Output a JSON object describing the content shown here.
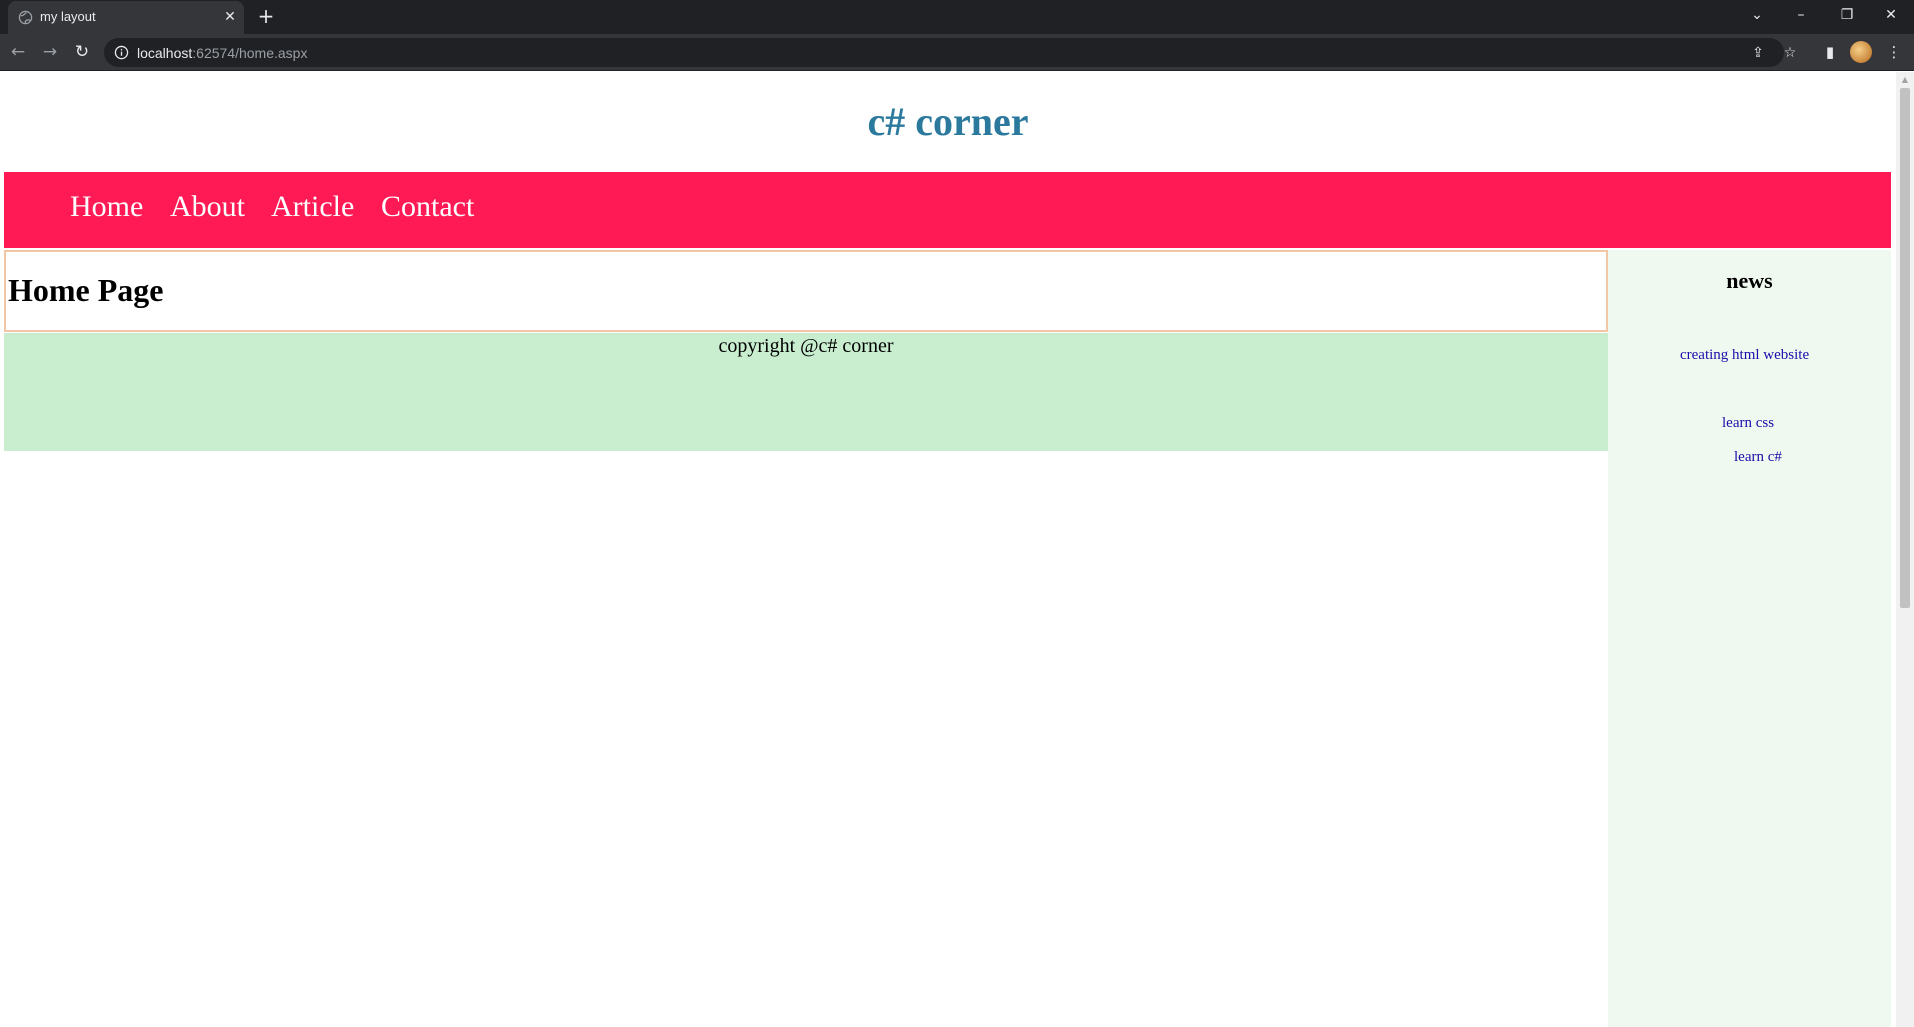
{
  "browser": {
    "tab_title": "my layout",
    "close_glyph": "✕",
    "new_tab_glyph": "+",
    "url_host": "localhost",
    "url_rest": ":62574/home.aspx",
    "window_controls": {
      "tab_search": "⌄",
      "minimize": "–",
      "restore": "❐",
      "close": "✕"
    },
    "nav_glyphs": {
      "back": "←",
      "forward": "→",
      "reload": "↻"
    },
    "toolbar_glyphs": {
      "share": "⇪",
      "bookmark": "☆",
      "side_panel": "▮",
      "menu": "⋮"
    }
  },
  "site": {
    "title": "c# corner",
    "nav_items": [
      "Home",
      "About",
      "Article",
      "Contact"
    ],
    "page_heading": "Home Page",
    "footer_text": "copyright @c# corner"
  },
  "sidebar": {
    "title": "news",
    "links": [
      "creating html website",
      "learn css",
      "learn c#"
    ]
  },
  "colors": {
    "title": "#2b7a9e",
    "navbar": "#ff1a55",
    "footer": "#c8eecf",
    "sidebar": "#f0f9ef",
    "link": "#1a0dab"
  }
}
